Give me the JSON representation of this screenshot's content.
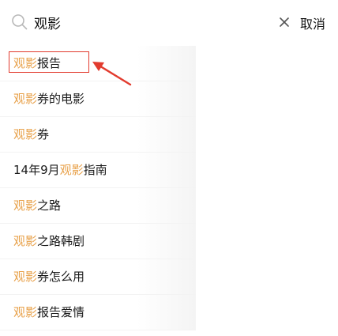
{
  "search": {
    "query": "观影",
    "cancel_label": "取消"
  },
  "suggestions": [
    {
      "segments": [
        {
          "text": "观影",
          "match": true
        },
        {
          "text": "报告",
          "match": false
        }
      ]
    },
    {
      "segments": [
        {
          "text": "观影",
          "match": true
        },
        {
          "text": "券的电影",
          "match": false
        }
      ]
    },
    {
      "segments": [
        {
          "text": "观影",
          "match": true
        },
        {
          "text": "券",
          "match": false
        }
      ]
    },
    {
      "segments": [
        {
          "text": "14年9月",
          "match": false
        },
        {
          "text": "观影",
          "match": true
        },
        {
          "text": "指南",
          "match": false
        }
      ]
    },
    {
      "segments": [
        {
          "text": "观影",
          "match": true
        },
        {
          "text": "之路",
          "match": false
        }
      ]
    },
    {
      "segments": [
        {
          "text": "观影",
          "match": true
        },
        {
          "text": "之路韩剧",
          "match": false
        }
      ]
    },
    {
      "segments": [
        {
          "text": "观影",
          "match": true
        },
        {
          "text": "券怎么用",
          "match": false
        }
      ]
    },
    {
      "segments": [
        {
          "text": "观影",
          "match": true
        },
        {
          "text": "报告爱情",
          "match": false
        }
      ]
    }
  ],
  "colors": {
    "match_highlight": "#e8a14a",
    "annotation_red": "#e23b2e"
  },
  "icons": [
    "search-icon",
    "clear-icon",
    "annotation-arrow"
  ]
}
